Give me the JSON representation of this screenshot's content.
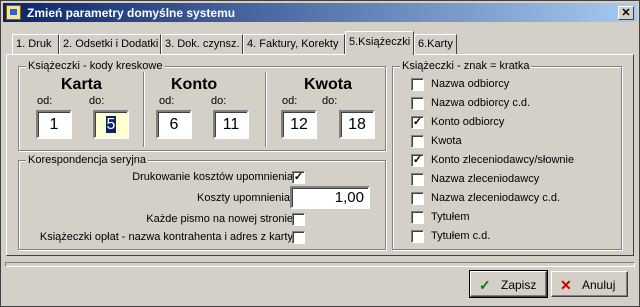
{
  "window": {
    "title": "Zmień parametry domyślne systemu",
    "close_label": "✕"
  },
  "tabs": [
    {
      "label": "1. Druk"
    },
    {
      "label": "2. Odsetki i Dodatki"
    },
    {
      "label": "3. Dok. czynsz."
    },
    {
      "label": "4. Faktury, Korekty"
    },
    {
      "label": "5.Książeczki"
    },
    {
      "label": "6.Karty"
    }
  ],
  "barcodes": {
    "legend": "Książeczki - kody kreskowe",
    "from_label": "od:",
    "to_label": "do:",
    "karta": {
      "title": "Karta",
      "from": "1",
      "to": "5"
    },
    "konto": {
      "title": "Konto",
      "from": "6",
      "to": "11"
    },
    "kwota": {
      "title": "Kwota",
      "from": "12",
      "to": "18"
    }
  },
  "correspondence": {
    "legend": "Korespondencja seryjna",
    "print_costs_label": "Drukowanie kosztów upomnienia",
    "print_costs_checked": true,
    "costs_label": "Koszty upomnienia:",
    "costs_value": "1,00",
    "new_page_label": "Każde pismo na nowej stronie",
    "new_page_checked": false,
    "fees_label": "Książeczki opłat - nazwa kontrahenta i adres z karty",
    "fees_checked": false
  },
  "sign": {
    "legend": "Książeczki - znak = kratka",
    "items": [
      {
        "label": "Nazwa odbiorcy",
        "checked": false
      },
      {
        "label": "Nazwa odbiorcy c.d.",
        "checked": false
      },
      {
        "label": "Konto odbiorcy",
        "checked": true
      },
      {
        "label": "Kwota",
        "checked": false
      },
      {
        "label": "Konto zleceniodawcy/słownie",
        "checked": true
      },
      {
        "label": "Nazwa zleceniodawcy",
        "checked": false
      },
      {
        "label": "Nazwa zleceniodawcy c.d.",
        "checked": false
      },
      {
        "label": "Tytułem",
        "checked": false
      },
      {
        "label": "Tytułem c.d.",
        "checked": false
      }
    ]
  },
  "buttons": {
    "save_label": "Zapisz",
    "cancel_label": "Anuluj"
  },
  "colors": {
    "title_start": "#0a246a",
    "title_end": "#a6caf0",
    "check_green": "#008000",
    "cancel_red": "#cc0000"
  }
}
